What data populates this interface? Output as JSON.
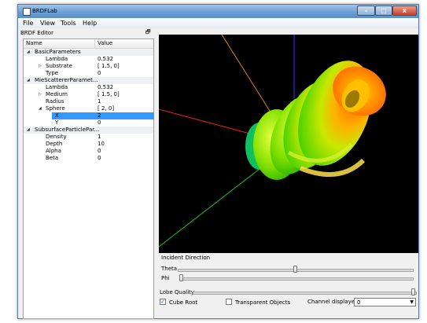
{
  "window": {
    "title": "BRDFLab",
    "min_glyph": "–",
    "max_glyph": "□",
    "close_glyph": "x"
  },
  "menu": [
    "File",
    "View",
    "Tools",
    "Help"
  ],
  "editor": {
    "title": "BRDF Editor",
    "float_glyph": "🗗",
    "columns": {
      "name": "Name",
      "value": "Value"
    },
    "rows": [
      {
        "name": "BasicParameters",
        "value": "",
        "level": 0,
        "arrow": "◢",
        "group": true
      },
      {
        "name": "Lambda",
        "value": "0.532",
        "level": 2,
        "arrow": ""
      },
      {
        "name": "Substrate",
        "value": "[ 1.5, 0]",
        "level": 2,
        "arrow": "▷"
      },
      {
        "name": "Type",
        "value": "0",
        "level": 2,
        "arrow": ""
      },
      {
        "name": "MieScattererParamet...",
        "value": "",
        "level": 0,
        "arrow": "◢",
        "group": true
      },
      {
        "name": "Lambda",
        "value": "0.532",
        "level": 2,
        "arrow": ""
      },
      {
        "name": "Medium",
        "value": "[ 1.5, 0]",
        "level": 2,
        "arrow": "▷"
      },
      {
        "name": "Radius",
        "value": "1",
        "level": 2,
        "arrow": ""
      },
      {
        "name": "Sphere",
        "value": "[ 2, 0]",
        "level": 2,
        "arrow": "◢"
      },
      {
        "name": "X",
        "value": "2",
        "level": 3,
        "arrow": "",
        "selected": true
      },
      {
        "name": "Y",
        "value": "0",
        "level": 3,
        "arrow": ""
      },
      {
        "name": "SubsurfaceParticlePar...",
        "value": "",
        "level": 0,
        "arrow": "◢",
        "group": true
      },
      {
        "name": "Density",
        "value": "1",
        "level": 2,
        "arrow": ""
      },
      {
        "name": "Depth",
        "value": "10",
        "level": 2,
        "arrow": ""
      },
      {
        "name": "Alpha",
        "value": "0",
        "level": 2,
        "arrow": ""
      },
      {
        "name": "Beta",
        "value": "0",
        "level": 2,
        "arrow": ""
      }
    ]
  },
  "controls": {
    "incident_direction_label": "Incident Direction",
    "theta_label": "Theta",
    "phi_label": "Phi",
    "theta_level": 0.5,
    "phi_level": 0.0,
    "lobe_quality_label": "Lobe Quality",
    "lobe_quality_level": 1.0,
    "cube_root_label": "Cube Root",
    "cube_root_checked": true,
    "check_glyph": "✓",
    "transparent_label": "Transparent Objects",
    "transparent_checked": false,
    "channel_label": "Channel displayed:",
    "channel_value": "0",
    "dropdown_glyph": "▼"
  },
  "colors": {
    "viewport_bg": "#000000",
    "axis_x": "#e02020",
    "axis_y": "#20c020",
    "axis_z": "#3030ff",
    "axis_extra": "#e08020",
    "selection": "#3399ff"
  },
  "icons": {
    "app": "app-icon",
    "float": "float-window-icon",
    "expand": "expand-arrow-icon",
    "collapse": "collapse-arrow-icon",
    "dropdown": "chevron-down-icon"
  }
}
